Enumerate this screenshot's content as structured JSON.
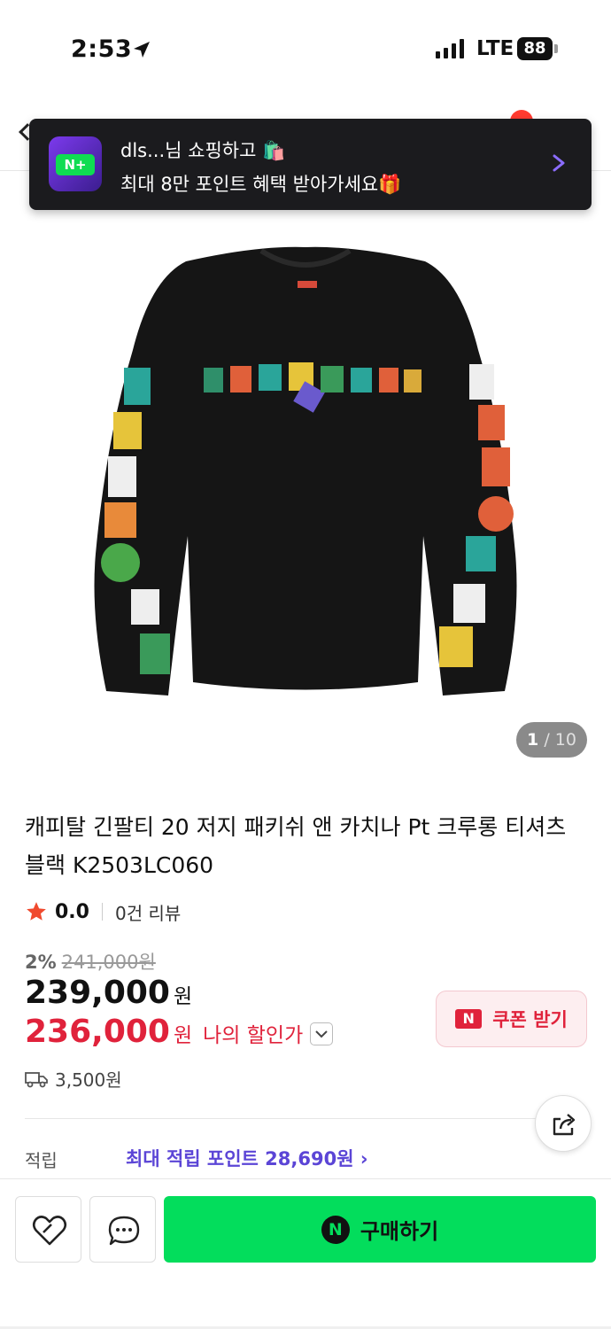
{
  "status_bar": {
    "time": "2:53",
    "network": "LTE",
    "battery": "88"
  },
  "toast": {
    "logo_text": "N+",
    "line1": "dls...님 쇼핑하고 🛍️",
    "line2": "최대 8만 포인트 혜택 받아가세요🎁"
  },
  "gallery": {
    "current": "1",
    "separator": " / ",
    "total": "10"
  },
  "product": {
    "title": "캐피탈 긴팔티 20 저지 패키쉬 앤 카치나 Pt 크루롱 티셔츠 블랙 K2503LC060",
    "rating": "0.0",
    "review_count": "0건 리뷰",
    "discount_rate": "2%",
    "original_price": "241,000원",
    "price": "239,000",
    "price_unit": "원",
    "my_price": "236,000",
    "my_price_unit": "원",
    "my_price_label": "나의 할인가",
    "shipping_fee": "3,500원"
  },
  "coupon": {
    "icon_text": "N",
    "label": "쿠폰 받기"
  },
  "points": {
    "label": "적립",
    "value": "최대 적립 포인트 28,690원 ›"
  },
  "bottom_bar": {
    "buy_icon_text": "N",
    "buy_label": "구매하기"
  },
  "colors": {
    "naver_green": "#03dd5c",
    "discount_red": "#e0223b",
    "points_purple": "#5b45d6"
  }
}
